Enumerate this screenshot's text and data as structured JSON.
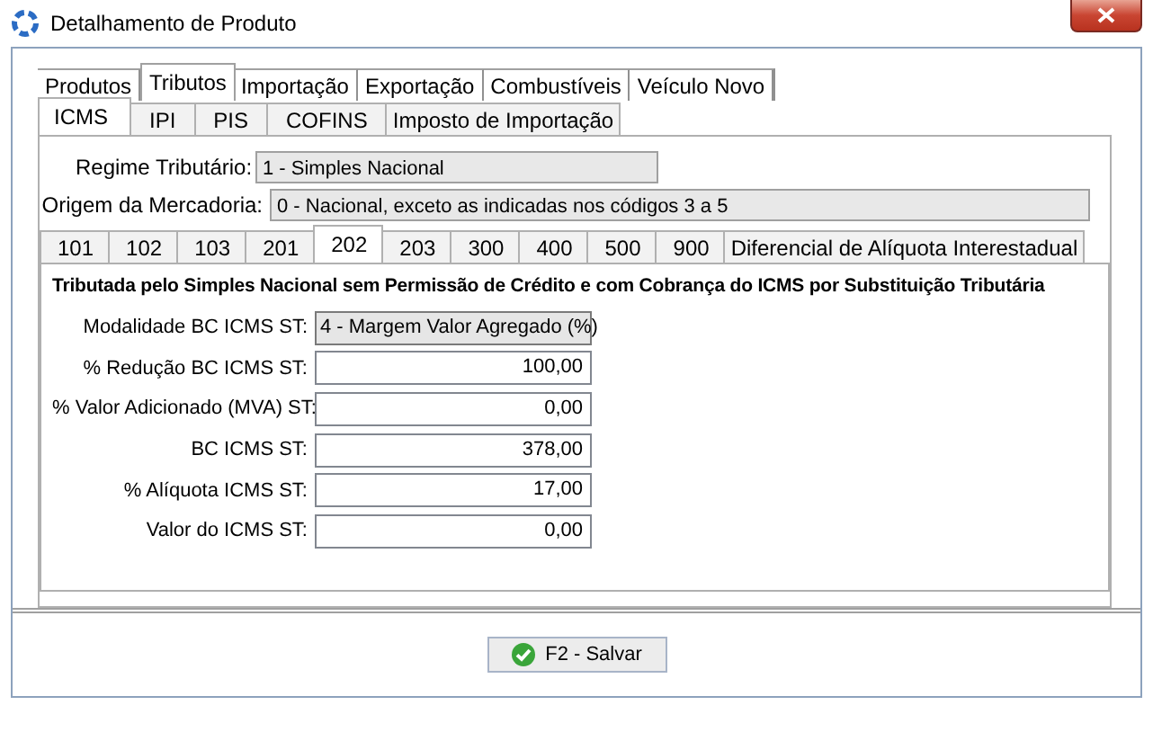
{
  "window": {
    "title": "Detalhamento de Produto"
  },
  "tabs": [
    {
      "label": "Produtos",
      "selected": false
    },
    {
      "label": "Tributos",
      "selected": true
    },
    {
      "label": "Importação",
      "selected": false
    },
    {
      "label": "Exportação",
      "selected": false
    },
    {
      "label": "Combustíveis",
      "selected": false
    },
    {
      "label": "Veículo Novo",
      "selected": false
    }
  ],
  "subtabs": [
    {
      "label": "ICMS",
      "selected": true
    },
    {
      "label": "IPI",
      "selected": false
    },
    {
      "label": "PIS",
      "selected": false
    },
    {
      "label": "COFINS",
      "selected": false
    },
    {
      "label": "Imposto de Importação",
      "selected": false
    }
  ],
  "regime": {
    "label": "Regime Tributário:",
    "value": "1 - Simples Nacional"
  },
  "origem": {
    "label": "Origem da Mercadoria:",
    "value": "0 - Nacional, exceto as indicadas nos códigos 3 a 5"
  },
  "cst_tabs": [
    {
      "label": "101",
      "selected": false
    },
    {
      "label": "102",
      "selected": false
    },
    {
      "label": "103",
      "selected": false
    },
    {
      "label": "201",
      "selected": false
    },
    {
      "label": "202",
      "selected": true
    },
    {
      "label": "203",
      "selected": false
    },
    {
      "label": "300",
      "selected": false
    },
    {
      "label": "400",
      "selected": false
    },
    {
      "label": "500",
      "selected": false
    },
    {
      "label": "900",
      "selected": false
    },
    {
      "label": "Diferencial de Alíquota Interestadual",
      "selected": false
    }
  ],
  "section_title": "Tributada pelo Simples Nacional sem Permissão de Crédito e com Cobrança do ICMS por Substituição Tributária",
  "fields": [
    {
      "label": "Modalidade BC ICMS ST:",
      "value": "4 - Margem Valor Agregado (%)",
      "kind": "select"
    },
    {
      "label": "% Redução BC ICMS ST:",
      "value": "100,00",
      "kind": "number"
    },
    {
      "label": "% Valor Adicionado (MVA) ST:",
      "value": "0,00",
      "kind": "number"
    },
    {
      "label": "BC ICMS ST:",
      "value": "378,00",
      "kind": "number"
    },
    {
      "label": "% Alíquota ICMS ST:",
      "value": "17,00",
      "kind": "number"
    },
    {
      "label": "Valor do ICMS ST:",
      "value": "0,00",
      "kind": "number"
    }
  ],
  "save_button": {
    "label": "F2 - Salvar"
  }
}
